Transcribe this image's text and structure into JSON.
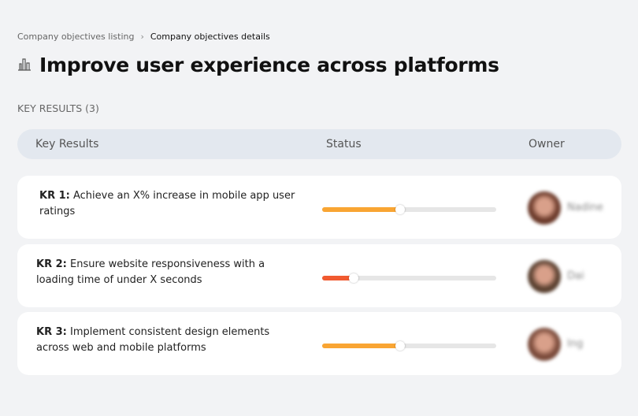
{
  "breadcrumb": {
    "parent": "Company objectives listing",
    "separator": "›",
    "current": "Company objectives details"
  },
  "title": {
    "icon": "building-chart-icon",
    "text": "Improve user experience across platforms"
  },
  "key_results_count_label": "KEY RESULTS (3)",
  "table": {
    "headers": {
      "key_results": "Key Results",
      "status": "Status",
      "owner": "Owner"
    },
    "rows": [
      {
        "id": "KR 1:",
        "text": "Achieve an X% increase in mobile app user ratings",
        "progress": 45,
        "color": "#f9a533",
        "owner": "Nadine",
        "avatar_color": "#6b3a2a"
      },
      {
        "id": "KR 2:",
        "text": "Ensure website responsiveness with a loading time of under X seconds",
        "progress": 18,
        "color": "#f15a30",
        "owner": "Dai",
        "avatar_color": "#5a4030"
      },
      {
        "id": "KR 3:",
        "text": "Implement consistent design elements across web and mobile platforms",
        "progress": 45,
        "color": "#f9a533",
        "owner": "Ing",
        "avatar_color": "#7a4a3a"
      }
    ]
  }
}
